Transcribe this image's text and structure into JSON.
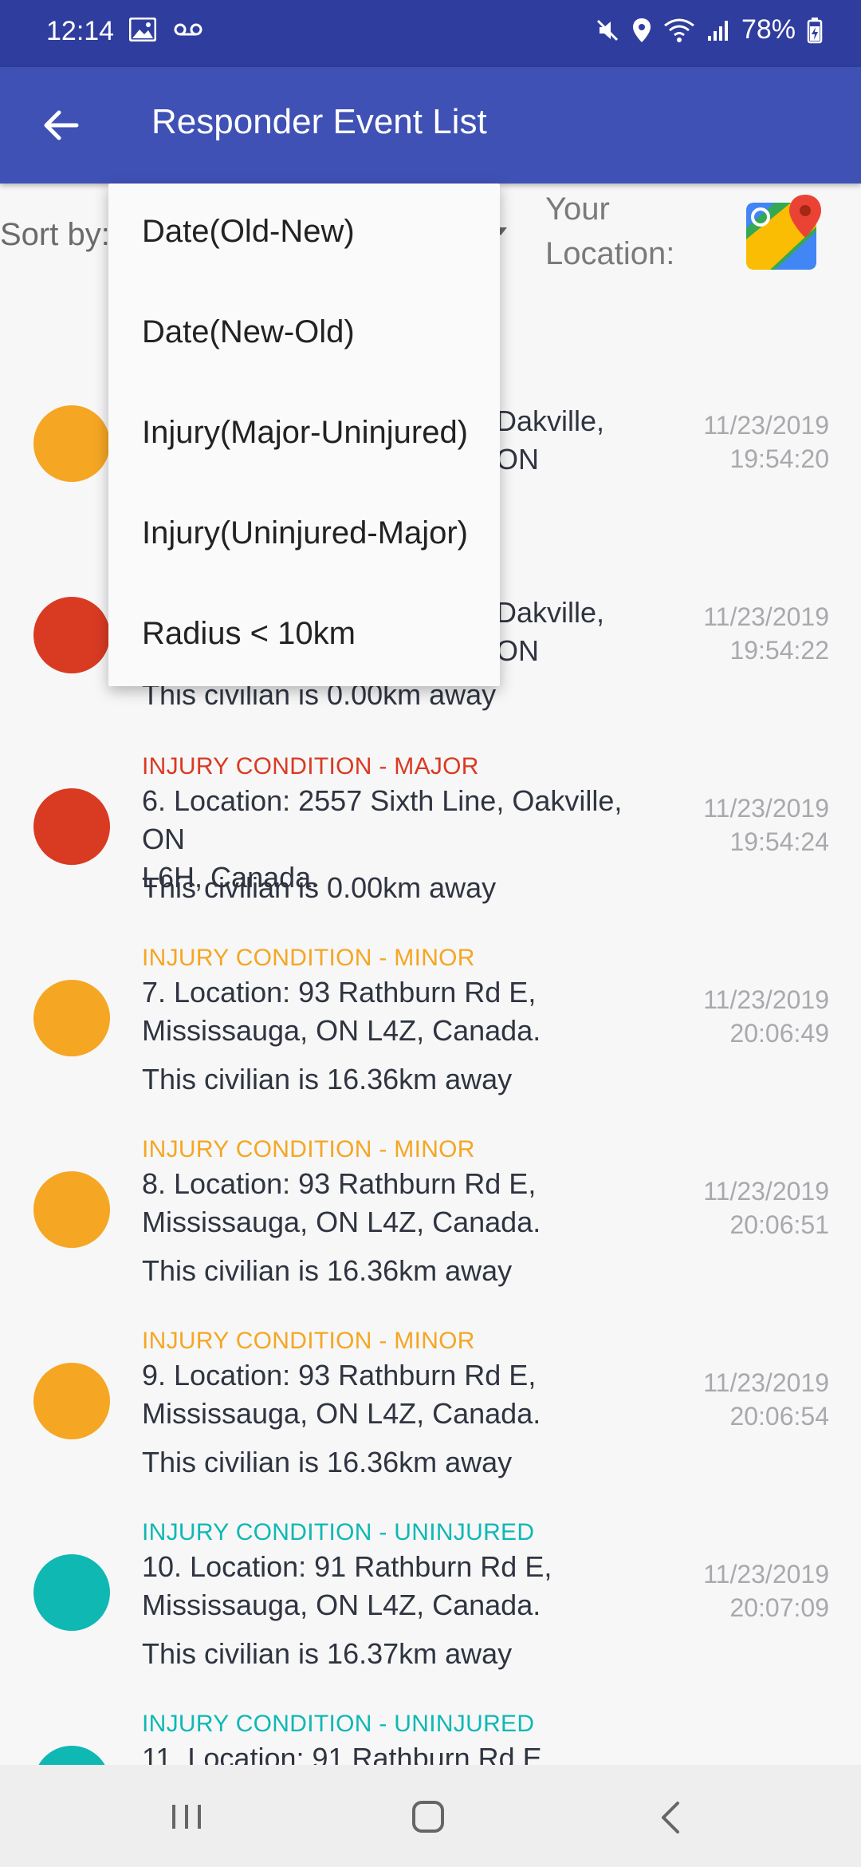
{
  "status": {
    "time": "12:14",
    "battery": "78%"
  },
  "appbar": {
    "title": "Responder Event List"
  },
  "sort": {
    "label": "Sort by:",
    "location_label": "Your Location:"
  },
  "dropdown": {
    "options": [
      "Date(Old-New)",
      "Date(New-Old)",
      "Injury(Major-Uninjured)",
      "Injury(Uninjured-Major)",
      "Radius < 10km"
    ]
  },
  "colors": {
    "major": "#d93a22",
    "minor": "#f5a623",
    "uninjured": "#0fb8b3",
    "primary": "#3f51b5",
    "primary_dark": "#2f3e9e"
  },
  "events": [
    {
      "addr_partial": "Dakville, ON",
      "date": "11/23/2019",
      "time": "19:54:20",
      "severity": "minor"
    },
    {
      "addr_partial": "Dakville, ON",
      "dist": "This civilian is 0.00km away",
      "date": "11/23/2019",
      "time": "19:54:22",
      "severity": "major"
    },
    {
      "cond": "INJURY CONDITION - MAJOR",
      "addr1": "6. Location: 2557 Sixth Line, Oakville, ON",
      "addr2": "L6H, Canada.",
      "dist": "This civilian is 0.00km away",
      "date": "11/23/2019",
      "time": "19:54:24",
      "severity": "major"
    },
    {
      "cond": "INJURY CONDITION - MINOR",
      "addr1": "7. Location: 93 Rathburn Rd E,",
      "addr2": "Mississauga, ON L4Z, Canada.",
      "dist": "This civilian is 16.36km away",
      "date": "11/23/2019",
      "time": "20:06:49",
      "severity": "minor"
    },
    {
      "cond": "INJURY CONDITION - MINOR",
      "addr1": "8. Location: 93 Rathburn Rd E,",
      "addr2": "Mississauga, ON L4Z, Canada.",
      "dist": "This civilian is 16.36km away",
      "date": "11/23/2019",
      "time": "20:06:51",
      "severity": "minor"
    },
    {
      "cond": "INJURY CONDITION - MINOR",
      "addr1": "9. Location: 93 Rathburn Rd E,",
      "addr2": "Mississauga, ON L4Z, Canada.",
      "dist": "This civilian is 16.36km away",
      "date": "11/23/2019",
      "time": "20:06:54",
      "severity": "minor"
    },
    {
      "cond": "INJURY CONDITION - UNINJURED",
      "addr1": "10. Location: 91 Rathburn Rd E,",
      "addr2": "Mississauga, ON L4Z, Canada.",
      "dist": "This civilian is 16.37km away",
      "date": "11/23/2019",
      "time": "20:07:09",
      "severity": "uninjured"
    },
    {
      "cond": "INJURY CONDITION - UNINJURED",
      "addr1": "11. Location: 91 Rathburn Rd E",
      "severity": "uninjured"
    }
  ]
}
